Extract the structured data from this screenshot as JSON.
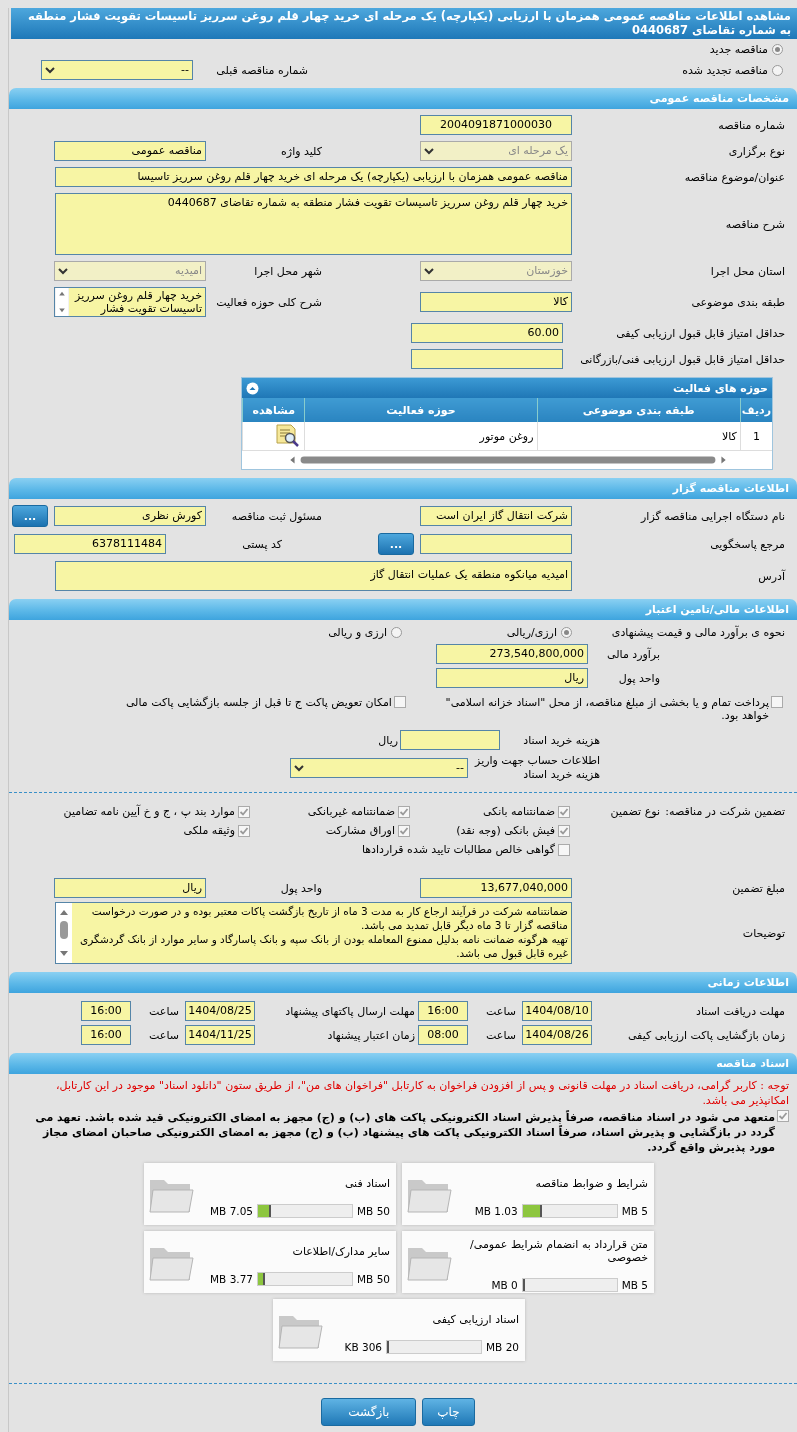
{
  "page_title": "مشاهده اطلاعات مناقصه عمومی همزمان با ارزیابی (یکپارچه) یک مرحله ای خرید چهار قلم روغن سرریز تاسیسات تقویت فشار منطقه به شماره تقاضای 0440687",
  "tender_kind": [
    {
      "label": "مناقصه جدید",
      "selected": true
    },
    {
      "label": "مناقصه تجدید شده",
      "selected": false
    }
  ],
  "previous_tender": {
    "label": "شماره مناقصه قبلی",
    "value": "--"
  },
  "general": {
    "heading": "مشخصات مناقصه عمومی",
    "rows": [
      [
        {
          "kind": "code",
          "label": "شماره مناقصه",
          "value": "2004091871000030"
        }
      ],
      [
        {
          "kind": "select",
          "label": "نوع برگزاری",
          "value": "یک مرحله ای",
          "disabled": true
        },
        {
          "kind": "text",
          "label": "کلید واژه",
          "value": "مناقصه عمومی"
        }
      ],
      [
        {
          "kind": "long",
          "label": "عنوان/موضوع مناقصه",
          "value": "مناقصه عمومی همزمان با ارزیابی (یکپارچه) یک مرحله ای خرید چهار قلم روغن سرریز تاسیسا"
        }
      ],
      [
        {
          "kind": "textarea",
          "label": "شرح مناقصه",
          "value": "خرید چهار قلم روغن سرریز تاسیسات تقویت فشار منطقه به شماره تقاضای 0440687"
        }
      ],
      [
        {
          "kind": "select",
          "label": "استان محل اجرا",
          "value": "خوزستان",
          "disabled": true
        },
        {
          "kind": "select",
          "label": "شهر محل اجرا",
          "value": "امیدیه",
          "disabled": true
        }
      ],
      [
        {
          "kind": "text",
          "label": "طبقه بندی موضوعی",
          "value": "کالا"
        },
        {
          "kind": "scroll",
          "label": "شرح کلی حوزه فعالیت",
          "value": "خرید چهار قلم روغن سرریز تاسیسات تقویت فشار"
        }
      ]
    ]
  },
  "scores": [
    {
      "label": "حداقل امتیاز قابل قبول ارزیابی کیفی",
      "value": "60.00"
    },
    {
      "label": "حداقل امتیاز قابل قبول ارزیابی فنی/بازرگانی"
    }
  ],
  "activities": {
    "heading": "حوزه های فعالیت",
    "columns": [
      "ردیف",
      "طبقه بندی موضوعی",
      "حوزه فعالیت",
      "مشاهده"
    ],
    "rows": [
      {
        "cells": [
          "1",
          "کالا",
          "روغن موتور"
        ]
      }
    ]
  },
  "tenderer": {
    "heading": "اطلاعات مناقصه گزار",
    "rows": [
      [
        {
          "kind": "text",
          "label": "نام دستگاه اجرایی مناقصه گزار",
          "value": "شرکت انتقال گاز ایران  است"
        },
        {
          "kind": "text",
          "label": "مسئول ثبت مناقصه",
          "value": "کورش نظری",
          "button": "..."
        }
      ],
      [
        {
          "kind": "text",
          "label": "مرجع پاسخگویی",
          "button": "..."
        },
        {
          "kind": "text",
          "label": "کد پستی",
          "value": "6378111484"
        }
      ],
      [
        {
          "kind": "address",
          "label": "آدرس",
          "value": "امیدیه میانکوه منطقه یک عملیات انتقال گاز"
        }
      ]
    ]
  },
  "finance": {
    "heading": "اطلاعات مالی/تامین اعتبار",
    "estimate_method": {
      "label": "نحوه ی برآورد مالی و قیمت پیشنهادی",
      "options": [
        {
          "label": "ارزی/ریالی",
          "selected": true
        },
        {
          "label": "ارزی و ریالی",
          "selected": false
        }
      ]
    },
    "estimate": {
      "label": "برآورد مالی",
      "value": "273,540,800,000"
    },
    "currency": {
      "label": "واحد پول",
      "value": "ریال"
    },
    "options": [
      {
        "label": "پرداخت تمام و یا بخشی از مبلغ مناقصه، از محل \"اسناد خزانه اسلامی\" خواهد بود.",
        "checked": false
      },
      {
        "label": "امکان تعویض پاکت ج تا قبل از جلسه بازگشایی پاکت مالی",
        "checked": false
      }
    ],
    "document_fee": {
      "label": "هزینه خرید اسناد",
      "unit": "ریال"
    },
    "fee_account": {
      "label": "اطلاعات حساب جهت واریز هزینه خرید اسناد",
      "value": "--"
    }
  },
  "guarantee": {
    "label": "تضمین شرکت در مناقصه:",
    "type_label": "نوع تضمین",
    "types": [
      {
        "label": "ضمانتنامه بانکی",
        "checked": true
      },
      {
        "label": "ضمانتنامه غیربانکی",
        "checked": true
      },
      {
        "label": "موارد بند پ ، ج و خ آیین نامه تضامین",
        "checked": true
      },
      {
        "label": "فیش بانکی (وجه نقد)",
        "checked": true
      },
      {
        "label": "اوراق مشارکت",
        "checked": true
      },
      {
        "label": "وثیقه ملکی",
        "checked": true
      },
      {
        "label": "گواهی خالص مطالبات تایید شده قراردادها",
        "checked": false
      }
    ],
    "amount": {
      "label": "مبلغ تضمین",
      "value": "13,677,040,000"
    },
    "currency": {
      "label": "واحد پول",
      "value": "ریال"
    },
    "notes": {
      "label": "توضیحات",
      "paragraphs": [
        "ضمانتنامه شرکت در فرآیند ارجاع کار به مدت 3 ماه از تاریخ بازگشت پاکات معتبر بوده و در صورت درخواست مناقصه گزار تا 3 ماه دیگر قابل تمدید می باشد.",
        "تهیه هرگونه ضمانت نامه بدلیل ممنوع المعامله بودن از بانک سپه و بانک پاسارگاد و سایر موارد از بانک گردشگری غیره قابل قبول می باشد."
      ]
    }
  },
  "schedule": {
    "heading": "اطلاعات زمانی",
    "items": [
      {
        "label": "مهلت دریافت اسناد",
        "date": "1404/08/10",
        "time_label": "ساعت",
        "time": "16:00"
      },
      {
        "label": "مهلت ارسال پاکتهای پیشنهاد",
        "date": "1404/08/25",
        "time_label": "ساعت",
        "time": "16:00"
      },
      {
        "label": "زمان بازگشایی پاکت ارزیابی کیفی",
        "date": "1404/08/26",
        "time_label": "ساعت",
        "time": "08:00"
      },
      {
        "label": "زمان اعتبار پیشنهاد",
        "date": "1404/11/25",
        "time_label": "ساعت",
        "time": "16:00"
      }
    ]
  },
  "documents": {
    "heading": "اسناد مناقصه",
    "notice": "توجه : کاربر گرامی، دریافت اسناد در مهلت قانونی و پس از افزودن فراخوان به کارتابل \"فراخوان های من\"، از طریق ستون \"دانلود اسناد\" موجود در این کارتابل، امکانپذیر می باشد.",
    "commitment": {
      "text": "متعهد می شود در اسناد مناقصه، صرفاً پذیرش اسناد الکترونیکی پاکت های (ب) و (ج) مجهز به امضای الکترونیکی قید شده باشد. تعهد می گردد در بازگشایی و پذیرش اسناد، صرفاً اسناد الکترونیکی پاکت های پیشنهاد (ب) و (ج) مجهز به امضای الکترونیکی صاحبان امضای مجاز مورد پذیرش واقع گردد.",
      "checked": true
    },
    "files": [
      {
        "name": "شرایط و ضوابط مناقصه",
        "limit": "5 MB",
        "size": "1.03 MB",
        "level": 0.21
      },
      {
        "name": "اسناد فنی",
        "limit": "50 MB",
        "size": "7.05 MB",
        "level": 0.14
      },
      {
        "name": "متن قرارداد به انضمام شرایط عمومی/خصوصی",
        "limit": "5 MB",
        "size": "0 MB",
        "level": 0
      },
      {
        "name": "سایر مدارک/اطلاعات",
        "limit": "50 MB",
        "size": "3.77 MB",
        "level": 0.075
      },
      {
        "name": "اسناد ارزیابی کیفی",
        "limit": "20 MB",
        "size": "306 KB",
        "level": 0.015
      }
    ]
  },
  "buttons": [
    "چاپ",
    "بازگشت"
  ]
}
